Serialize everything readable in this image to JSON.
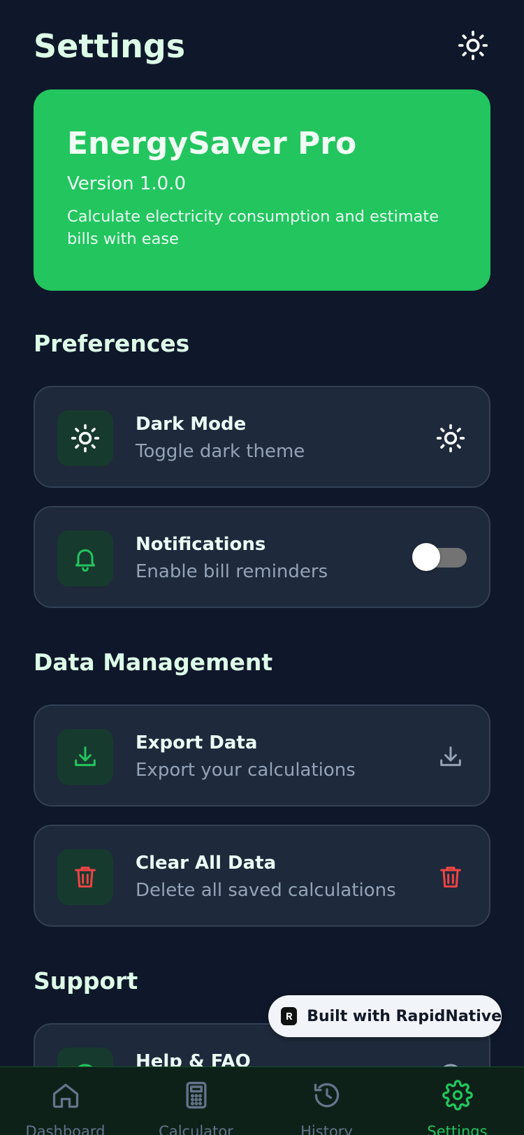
{
  "header": {
    "title": "Settings",
    "theme_toggle_icon": "sun-icon"
  },
  "app_info": {
    "name": "EnergySaver Pro",
    "version": "Version 1.0.0",
    "description": "Calculate electricity consumption and estimate bills with ease"
  },
  "sections": {
    "preferences": {
      "title": "Preferences",
      "items": [
        {
          "title": "Dark Mode",
          "subtitle": "Toggle dark theme",
          "icon": "sun-icon",
          "right_icon": "sun-icon"
        },
        {
          "title": "Notifications",
          "subtitle": "Enable bill reminders",
          "icon": "bell-icon",
          "toggle_on": false
        }
      ]
    },
    "data_management": {
      "title": "Data Management",
      "items": [
        {
          "title": "Export Data",
          "subtitle": "Export your calculations",
          "icon": "download-icon",
          "right_icon": "download-icon"
        },
        {
          "title": "Clear All Data",
          "subtitle": "Delete all saved calculations",
          "icon": "trash-icon",
          "right_icon": "trash-icon"
        }
      ]
    },
    "support": {
      "title": "Support",
      "items": [
        {
          "title": "Help & FAQ",
          "icon": "help-icon"
        }
      ]
    }
  },
  "badge": {
    "text": "Built with RapidNative"
  },
  "bottom_nav": {
    "active": "Settings",
    "items": [
      {
        "label": "Dashboard",
        "icon": "home-icon"
      },
      {
        "label": "Calculator",
        "icon": "calculator-icon"
      },
      {
        "label": "History",
        "icon": "history-icon"
      },
      {
        "label": "Settings",
        "icon": "gear-icon"
      }
    ]
  },
  "colors": {
    "background": "#0f172a",
    "card": "#1e293b",
    "accent": "#22c55e",
    "danger": "#ef4444",
    "heading": "#dcfce7",
    "muted": "#94a3b8"
  }
}
